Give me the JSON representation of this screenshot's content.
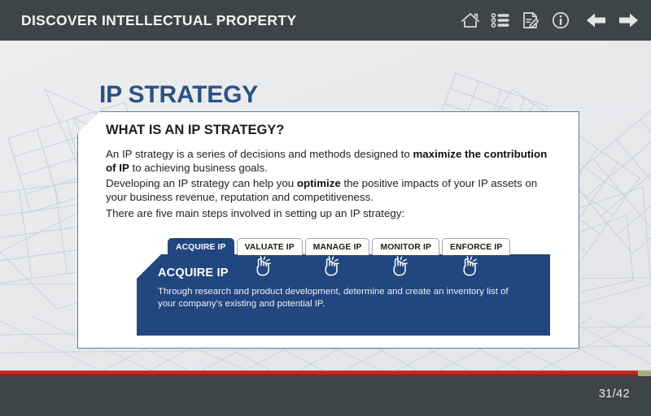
{
  "header": {
    "course_title": "DISCOVER INTELLECTUAL PROPERTY",
    "bar_color": "#3e4546",
    "icons": [
      {
        "name": "home-icon",
        "label": "Home"
      },
      {
        "name": "menu-list-icon",
        "label": "Menu"
      },
      {
        "name": "notes-icon",
        "label": "Notes"
      },
      {
        "name": "info-icon",
        "label": "Info"
      },
      {
        "name": "previous-arrow-icon",
        "label": "Previous"
      },
      {
        "name": "next-arrow-icon",
        "label": "Next"
      }
    ]
  },
  "slide": {
    "title": "IP STRATEGY",
    "title_color": "#2b5285",
    "card_heading": "WHAT IS AN IP STRATEGY?",
    "paragraphs": [
      {
        "segments": [
          {
            "text": "An IP strategy is a series of decisions and methods designed to ",
            "bold": false
          },
          {
            "text": "maximize the contribution of IP",
            "bold": true
          },
          {
            "text": " to achieving business goals.",
            "bold": false
          }
        ]
      },
      {
        "segments": [
          {
            "text": "Developing an IP strategy can help you ",
            "bold": false
          },
          {
            "text": "optimize",
            "bold": true
          },
          {
            "text": " the positive impacts of your IP assets on your business revenue, reputation and competitiveness.",
            "bold": false
          }
        ]
      },
      {
        "segments": [
          {
            "text": "There are five main steps involved in setting up an IP strategy:",
            "bold": false
          }
        ]
      }
    ]
  },
  "tabs": {
    "active_index": 0,
    "active_color": "#22467f",
    "items": [
      {
        "label": "ACQUIRE IP",
        "active": true
      },
      {
        "label": "VALUATE IP",
        "active": false
      },
      {
        "label": "MANAGE IP",
        "active": false
      },
      {
        "label": "MONITOR IP",
        "active": false
      },
      {
        "label": "ENFORCE IP",
        "active": false
      }
    ]
  },
  "panel": {
    "title": "ACQUIRE IP",
    "body": "Through research and product development, determine and create an inventory list of your company's existing and potential IP.",
    "background": "#22467f"
  },
  "footer": {
    "page_indicator": "31/42",
    "progress_percent": 98,
    "progress_color": "#b5261c",
    "track_color": "#a8ac7a",
    "bar_color": "#3e4546"
  }
}
